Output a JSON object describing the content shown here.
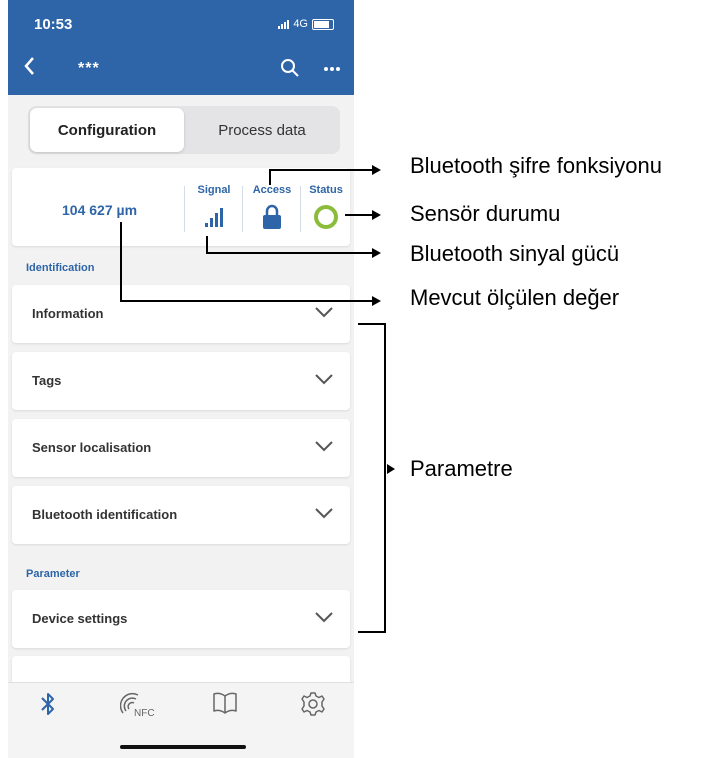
{
  "status_bar": {
    "time": "10:53",
    "network": "4G"
  },
  "header": {
    "title": "***"
  },
  "segments": {
    "active": "Configuration",
    "inactive": "Process data"
  },
  "status_card": {
    "measurement": "104 627 µm",
    "signal_label": "Signal",
    "access_label": "Access",
    "status_label": "Status"
  },
  "sections": {
    "identification": "Identification",
    "parameter": "Parameter"
  },
  "identification_items": [
    {
      "label": "Information"
    },
    {
      "label": "Tags"
    },
    {
      "label": "Sensor localisation"
    },
    {
      "label": "Bluetooth identification"
    }
  ],
  "parameter_items": [
    {
      "label": "Device settings"
    }
  ],
  "bottom_tabs": [
    "bluetooth-icon",
    "nfc-icon",
    "book-icon",
    "settings-icon"
  ],
  "bottom_tabs_nfc_label": "NFC",
  "annotations": {
    "password": "Bluetooth şifre fonksiyonu",
    "sensor_status": "Sensör durumu",
    "signal_strength": "Bluetooth sinyal gücü",
    "current_value": "Mevcut ölçülen değer",
    "parameter": "Parametre"
  },
  "colors": {
    "primary": "#2d65a8",
    "status_ok": "#8cbd3a"
  }
}
